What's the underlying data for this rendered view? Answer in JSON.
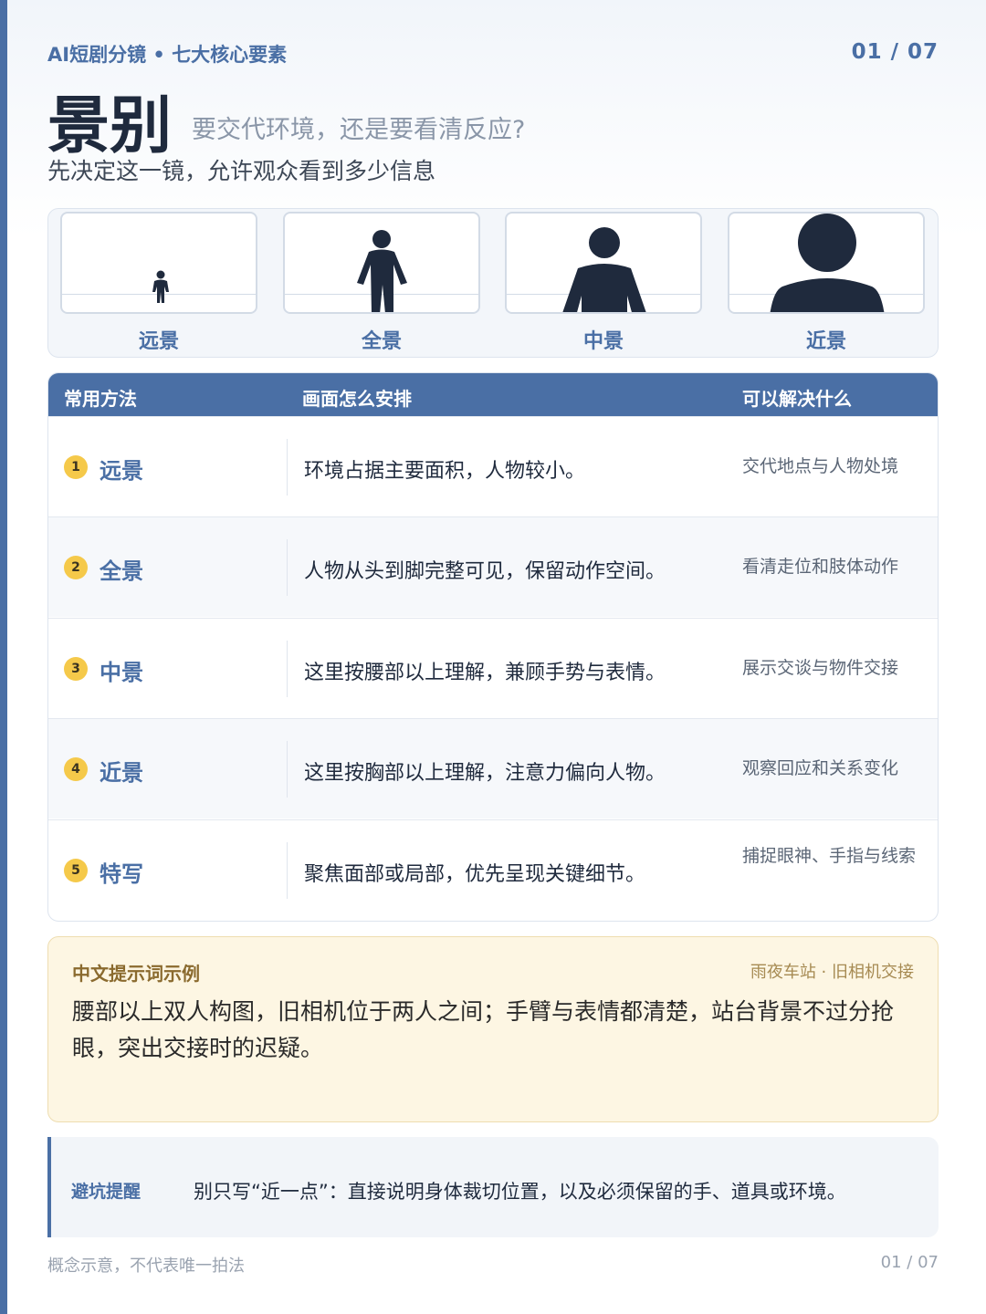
{
  "header": {
    "series": "AI短剧分镜 • 七大核心要素",
    "pager": "01 / 07",
    "title": "景别",
    "question": "要交代环境，还是要看清反应?",
    "subtitle": "先决定这一镜，允许观众看到多少信息"
  },
  "shots": [
    {
      "label": "远景",
      "icon": "tiny-standing-figure-icon"
    },
    {
      "label": "全景",
      "icon": "full-body-figure-icon"
    },
    {
      "label": "中景",
      "icon": "waist-up-figure-icon"
    },
    {
      "label": "近景",
      "icon": "chest-up-figure-icon"
    }
  ],
  "table": {
    "headers": [
      "常用方法",
      "画面怎么安排",
      "可以解决什么"
    ],
    "rows": [
      {
        "num": "1",
        "method": "远景",
        "arrange": "环境占据主要面积，人物较小。",
        "solve": "交代地点与人物处境"
      },
      {
        "num": "2",
        "method": "全景",
        "arrange": "人物从头到脚完整可见，保留动作空间。",
        "solve": "看清走位和肢体动作"
      },
      {
        "num": "3",
        "method": "中景",
        "arrange": "这里按腰部以上理解，兼顾手势与表情。",
        "solve": "展示交谈与物件交接"
      },
      {
        "num": "4",
        "method": "近景",
        "arrange": "这里按胸部以上理解，注意力偏向人物。",
        "solve": "观察回应和关系变化"
      },
      {
        "num": "5",
        "method": "特写",
        "arrange": "聚焦面部或局部，优先呈现关键细节。",
        "solve": "捕捉眼神、手指与线索"
      }
    ]
  },
  "prompt": {
    "title": "中文提示词示例",
    "scene": "雨夜车站 · 旧相机交接",
    "text": "腰部以上双人构图，旧相机位于两人之间；手臂与表情都清楚，站台背景不过分抢眼，突出交接时的迟疑。"
  },
  "tip": {
    "label": "避坑提醒",
    "text": "别只写“近一点”：直接说明身体裁切位置，以及必须保留的手、道具或环境。"
  },
  "footer": {
    "note": "概念示意，不代表唯一拍法",
    "pager": "01 / 07"
  },
  "colors": {
    "accent": "#4a6fa5",
    "figure": "#1f2a3d",
    "badge": "#f5c94a",
    "prompt_bg": "#fdf6e3"
  }
}
